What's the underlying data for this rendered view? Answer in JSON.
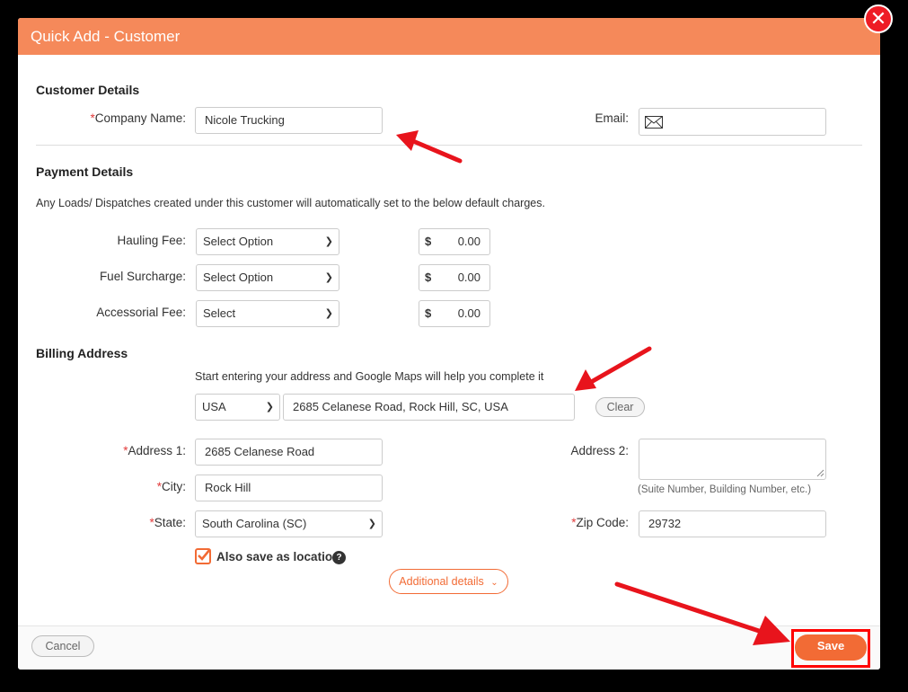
{
  "header": {
    "title": "Quick Add - Customer",
    "close_icon": "close-icon"
  },
  "customer": {
    "section_title": "Customer Details",
    "company_label": "Company Name:",
    "company_value": "Nicole Trucking",
    "email_label": "Email:",
    "email_value": "",
    "email_icon": "envelope-icon"
  },
  "payment": {
    "section_title": "Payment Details",
    "description": "Any Loads/ Dispatches created under this customer will automatically set to the below default charges.",
    "rows": [
      {
        "label": "Hauling Fee:",
        "select": "Select Option",
        "currency": "$",
        "amount": "0.00"
      },
      {
        "label": "Fuel Surcharge:",
        "select": "Select Option",
        "currency": "$",
        "amount": "0.00"
      },
      {
        "label": "Accessorial Fee:",
        "select": "Select",
        "currency": "$",
        "amount": "0.00"
      }
    ]
  },
  "billing": {
    "section_title": "Billing Address",
    "help": "Start entering your address and Google Maps will help you complete it",
    "country": "USA",
    "search_value": "2685 Celanese Road, Rock Hill, SC, USA",
    "clear_label": "Clear",
    "address1_label": "Address 1:",
    "address1_value": "2685 Celanese Road",
    "address2_label": "Address 2:",
    "address2_value": "",
    "address2_hint": "(Suite Number, Building Number, etc.)",
    "city_label": "City:",
    "city_value": "Rock Hill",
    "state_label": "State:",
    "state_value": "South Carolina (SC)",
    "zip_label": "Zip Code:",
    "zip_value": "29732",
    "save_location_label": "Also save as location",
    "save_location_checked": true,
    "additional_label": "Additional details"
  },
  "footer": {
    "cancel_label": "Cancel",
    "save_label": "Save"
  },
  "required_mark": "*",
  "colors": {
    "header": "#f5895a",
    "accent": "#f26b35",
    "annotation": "#ff0000"
  }
}
